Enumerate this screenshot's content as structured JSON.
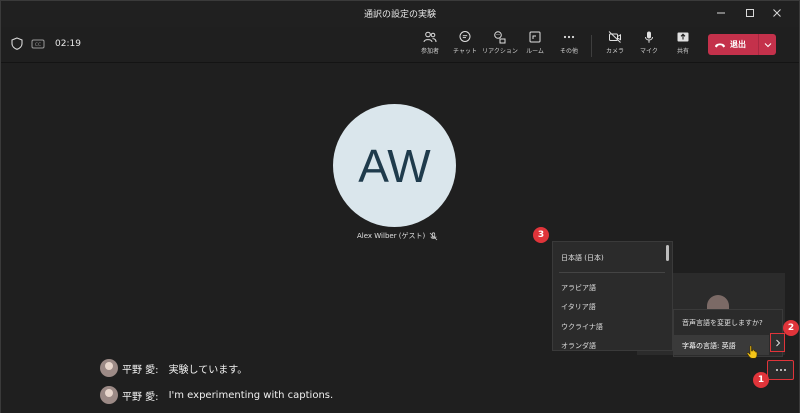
{
  "window": {
    "title": "通訳の設定の実験"
  },
  "toolbar": {
    "timer": "02:19",
    "buttons": [
      {
        "label": "参加者",
        "icon": "participants-icon"
      },
      {
        "label": "チャット",
        "icon": "chat-icon"
      },
      {
        "label": "リアクション",
        "icon": "reaction-icon"
      },
      {
        "label": "ルーム",
        "icon": "rooms-icon"
      },
      {
        "label": "その他",
        "icon": "more-icon"
      },
      {
        "label": "カメラ",
        "icon": "camera-off-icon"
      },
      {
        "label": "マイク",
        "icon": "mic-icon"
      },
      {
        "label": "共有",
        "icon": "share-icon"
      }
    ],
    "leave_label": "退出"
  },
  "stage": {
    "participant_initials": "AW",
    "participant_name": "Alex Wilber (ゲスト)"
  },
  "language_list": {
    "selected": "日本語 (日本)",
    "items": [
      "アラビア語",
      "イタリア語",
      "ウクライナ語",
      "オランダ語"
    ]
  },
  "caption_menu": {
    "question": "音声言語を変更しますか?",
    "caption_language": "字幕の言語: 英語"
  },
  "badges": [
    "1",
    "2",
    "3"
  ],
  "captions": [
    {
      "speaker": "平野 愛:",
      "text": "実験しています。"
    },
    {
      "speaker": "平野 愛:",
      "text": "I'm experimenting with captions."
    }
  ],
  "colors": {
    "leave": "#c4314b",
    "badge": "#e0343a",
    "avatar_bg": "#dae6ec"
  }
}
